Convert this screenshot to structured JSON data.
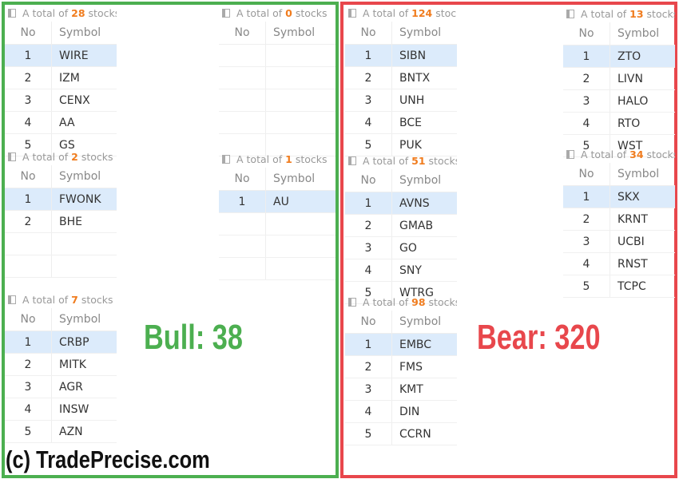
{
  "colors": {
    "bull": "#4caf50",
    "bear": "#e8474c",
    "count": "#f07c1e",
    "selected_row": "#dcebfb"
  },
  "labels": {
    "prefix": "A total of",
    "suffix": "stocks",
    "col_no": "No",
    "col_symbol": "Symbol"
  },
  "bull": {
    "label": "Bull: 38"
  },
  "bear": {
    "label": "Bear: 320"
  },
  "watermark": "(c) TradePrecise.com",
  "panels": [
    {
      "group": "bull",
      "count": "28",
      "rows": [
        [
          "1",
          "WIRE"
        ],
        [
          "2",
          "IZM"
        ],
        [
          "3",
          "CENX"
        ],
        [
          "4",
          "AA"
        ],
        [
          "5",
          "GS"
        ]
      ]
    },
    {
      "group": "bull",
      "count": "0",
      "rows": []
    },
    {
      "group": "bull",
      "count": "2",
      "rows": [
        [
          "1",
          "FWONK"
        ],
        [
          "2",
          "BHE"
        ]
      ]
    },
    {
      "group": "bull",
      "count": "1",
      "rows": [
        [
          "1",
          "AU"
        ]
      ]
    },
    {
      "group": "bull",
      "count": "7",
      "rows": [
        [
          "1",
          "CRBP"
        ],
        [
          "2",
          "MITK"
        ],
        [
          "3",
          "AGR"
        ],
        [
          "4",
          "INSW"
        ],
        [
          "5",
          "AZN"
        ]
      ]
    },
    {
      "group": "bear",
      "count": "124",
      "rows": [
        [
          "1",
          "SIBN"
        ],
        [
          "2",
          "BNTX"
        ],
        [
          "3",
          "UNH"
        ],
        [
          "4",
          "BCE"
        ],
        [
          "5",
          "PUK"
        ]
      ]
    },
    {
      "group": "bear",
      "count": "13",
      "rows": [
        [
          "1",
          "ZTO"
        ],
        [
          "2",
          "LIVN"
        ],
        [
          "3",
          "HALO"
        ],
        [
          "4",
          "RTO"
        ],
        [
          "5",
          "WST"
        ]
      ]
    },
    {
      "group": "bear",
      "count": "51",
      "rows": [
        [
          "1",
          "AVNS"
        ],
        [
          "2",
          "GMAB"
        ],
        [
          "3",
          "GO"
        ],
        [
          "4",
          "SNY"
        ],
        [
          "5",
          "WTRG"
        ]
      ]
    },
    {
      "group": "bear",
      "count": "34",
      "rows": [
        [
          "1",
          "SKX"
        ],
        [
          "2",
          "KRNT"
        ],
        [
          "3",
          "UCBI"
        ],
        [
          "4",
          "RNST"
        ],
        [
          "5",
          "TCPC"
        ]
      ]
    },
    {
      "group": "bear",
      "count": "98",
      "rows": [
        [
          "1",
          "EMBC"
        ],
        [
          "2",
          "FMS"
        ],
        [
          "3",
          "KMT"
        ],
        [
          "4",
          "DIN"
        ],
        [
          "5",
          "CCRN"
        ]
      ]
    }
  ]
}
